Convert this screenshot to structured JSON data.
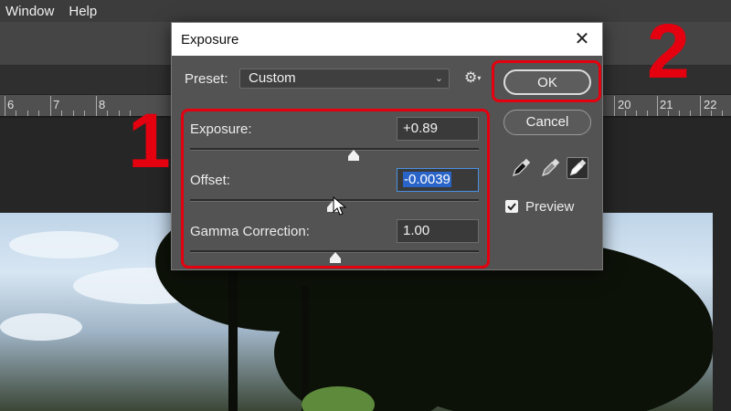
{
  "menubar": {
    "items": [
      "Window",
      "Help"
    ]
  },
  "ruler": {
    "numbers": [
      "6",
      "7",
      "8",
      "20",
      "21",
      "22"
    ]
  },
  "dialog": {
    "title": "Exposure",
    "preset_label": "Preset:",
    "preset_value": "Custom",
    "fields": [
      {
        "label": "Exposure:",
        "value": "+0.89",
        "slider_fraction": 0.55
      },
      {
        "label": "Offset:",
        "value": "-0.0039",
        "slider_fraction": 0.5
      },
      {
        "label": "Gamma Correction:",
        "value": "1.00",
        "slider_fraction": 0.5
      }
    ],
    "ok_label": "OK",
    "cancel_label": "Cancel",
    "preview_label": "Preview",
    "preview_checked": true
  },
  "callouts": {
    "one": "1",
    "two": "2"
  },
  "colors": {
    "highlight": "#e4000f",
    "dialog_bg": "#535353",
    "selection": "#2a64c8"
  },
  "icons": [
    "close-icon",
    "chevron-down-icon",
    "gear-icon",
    "eyedropper-black-icon",
    "eyedropper-gray-icon",
    "eyedropper-white-icon",
    "checkmark-icon",
    "cursor-icon"
  ]
}
